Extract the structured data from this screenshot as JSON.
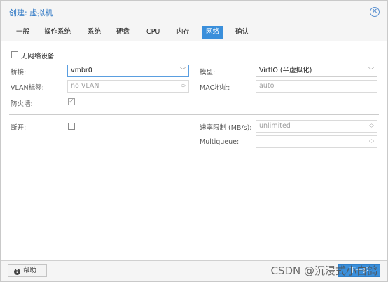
{
  "window": {
    "title": "创建: 虚拟机"
  },
  "tabs": [
    {
      "label": "一般"
    },
    {
      "label": "操作系统"
    },
    {
      "label": "系统"
    },
    {
      "label": "硬盘"
    },
    {
      "label": "CPU"
    },
    {
      "label": "内存"
    },
    {
      "label": "网络",
      "active": true
    },
    {
      "label": "确认"
    }
  ],
  "form": {
    "no_network_label": "无网络设备",
    "bridge_label": "桥接:",
    "bridge_value": "vmbr0",
    "model_label": "模型:",
    "model_value": "VirtIO (半虚拟化)",
    "vlan_label": "VLAN标签:",
    "vlan_placeholder": "no VLAN",
    "mac_label": "MAC地址:",
    "mac_placeholder": "auto",
    "firewall_label": "防火墙:",
    "firewall_checked": true,
    "disconnect_label": "断开:",
    "rate_label": "速率限制 (MB/s):",
    "rate_placeholder": "unlimited",
    "multiqueue_label": "Multiqueue:"
  },
  "footer": {
    "help_label": "帮助",
    "next_label": "下一步",
    "watermark": "CSDN @沉浸式小白鸽"
  },
  "colors": {
    "accent": "#3a8fdb",
    "title": "#2a75c4"
  }
}
